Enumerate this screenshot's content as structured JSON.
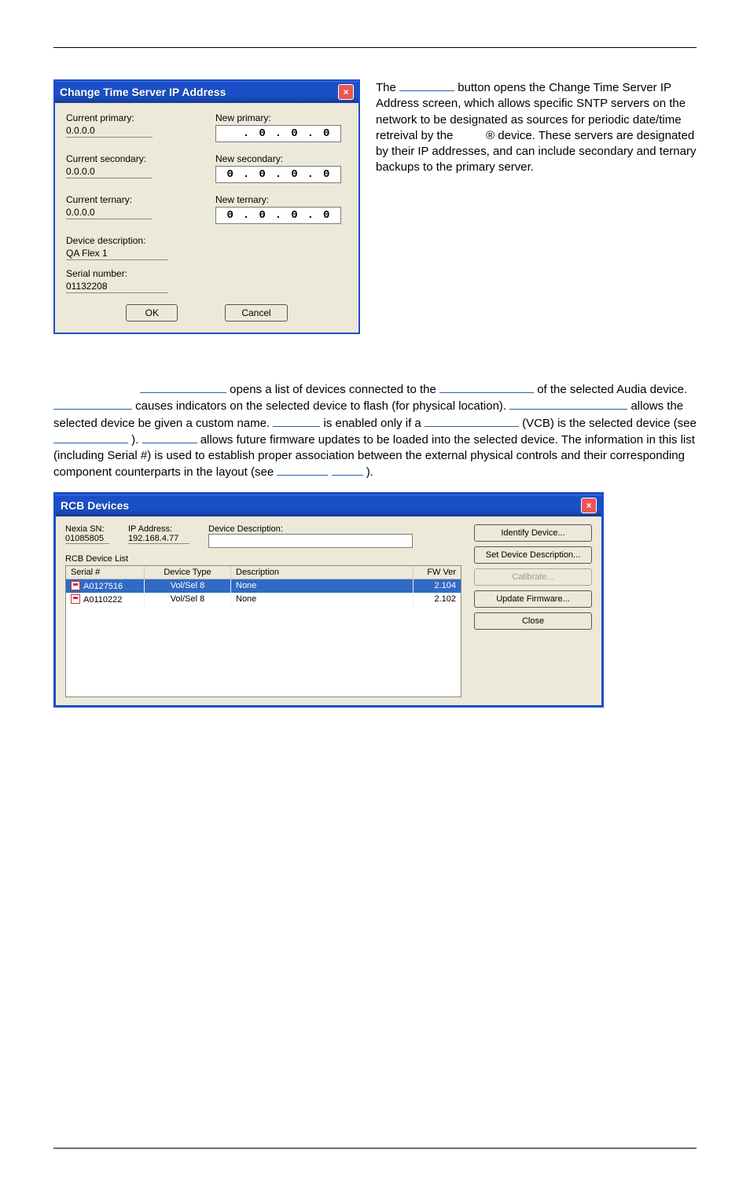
{
  "dialog1": {
    "title": "Change Time Server IP Address",
    "current_primary_label": "Current primary:",
    "current_primary_value": "0.0.0.0",
    "new_primary_label": "New primary:",
    "new_primary_value": [
      "",
      "0",
      "0",
      "0"
    ],
    "current_secondary_label": "Current secondary:",
    "current_secondary_value": "0.0.0.0",
    "new_secondary_label": "New secondary:",
    "new_secondary_value": [
      "0",
      "0",
      "0",
      "0"
    ],
    "current_ternary_label": "Current ternary:",
    "current_ternary_value": "0.0.0.0",
    "new_ternary_label": "New ternary:",
    "new_ternary_value": [
      "0",
      "0",
      "0",
      "0"
    ],
    "device_desc_label": "Device description:",
    "device_desc_value": "QA Flex 1",
    "serial_label": "Serial number:",
    "serial_value": "01132208",
    "ok": "OK",
    "cancel": "Cancel"
  },
  "side_para": {
    "t1": "The ",
    "t2": " button opens the Change Time Server IP Address screen, which allows specific SNTP servers on the network to be designated as sources for periodic date/time retreival by the ",
    "reg": "®",
    "t3": " device. These servers are designated by their IP addresses, and can include secondary and ternary backups to the primary server."
  },
  "para2": {
    "p1a": " opens a list of devices connected to the ",
    "p1b": " of the selected Audia device. ",
    "p2a": " causes indicators on the selected device to flash (for physical location). ",
    "p3a": " allows the selected device be given a custom name. ",
    "p3b": " is enabled only if a ",
    "p3c": " (VCB) is the selected device (see ",
    "p3d": "). ",
    "p4a": " allows future firmware updates to be loaded into the selected device. The information in this list (including Serial #) is used to establish proper association between the external physical controls and their corresponding component counterparts in the layout (see ",
    "p4b": ")."
  },
  "dialog2": {
    "title": "RCB Devices",
    "nexia_sn_label": "Nexia SN:",
    "nexia_sn_value": "01085805",
    "ip_label": "IP Address:",
    "ip_value": "192.168.4.77",
    "dev_desc_label": "Device Description:",
    "list_label": "RCB Device List",
    "columns": {
      "serial": "Serial #",
      "type": "Device Type",
      "desc": "Description",
      "fw": "FW Ver"
    },
    "rows": [
      {
        "serial": "A0127516",
        "type": "Vol/Sel 8",
        "desc": "None",
        "fw": "2.104",
        "selected": true
      },
      {
        "serial": "A0110222",
        "type": "Vol/Sel 8",
        "desc": "None",
        "fw": "2.102",
        "selected": false
      }
    ],
    "buttons": {
      "identify": "Identify Device...",
      "set_desc": "Set Device Description...",
      "calibrate": "Calibrate...",
      "update_fw": "Update Firmware...",
      "close": "Close"
    }
  }
}
